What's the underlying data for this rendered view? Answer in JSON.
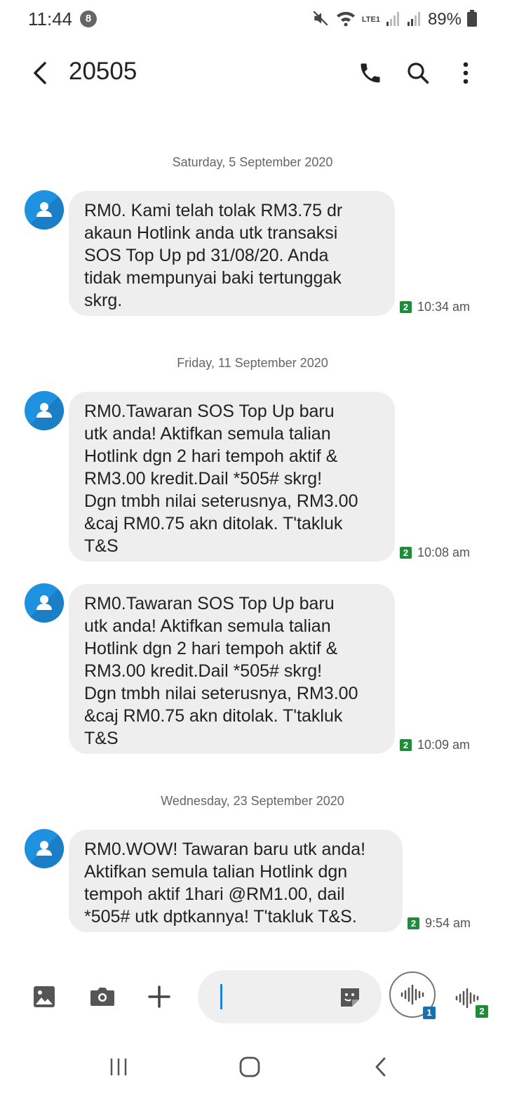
{
  "status_bar": {
    "time": "11:44",
    "notification_count": "8",
    "battery": "89%",
    "network": "LTE1"
  },
  "header": {
    "title": "20505",
    "icons": [
      "back-arrow-icon",
      "phone-icon",
      "search-icon",
      "more-vert-icon"
    ]
  },
  "conversation": [
    {
      "date": "Saturday, 5 September 2020",
      "messages": [
        {
          "text": "RM0. Kami telah tolak RM3.75 dr\nakaun Hotlink anda utk transaksi\nSOS Top Up pd 31/08/20. Anda\ntidak mempunyai baki tertunggak\nskrg.",
          "sim": "2",
          "time": "10:34 am"
        }
      ]
    },
    {
      "date": "Friday, 11 September 2020",
      "messages": [
        {
          "text": "RM0.Tawaran SOS Top Up baru\nutk anda! Aktifkan semula talian\nHotlink dgn 2 hari tempoh aktif &\nRM3.00 kredit.Dail *505#  skrg!\nDgn tmbh nilai seterusnya, RM3.00\n&caj RM0.75 akn ditolak. T'takluk\nT&S",
          "sim": "2",
          "time": "10:08 am"
        },
        {
          "text": "RM0.Tawaran SOS Top Up baru\nutk anda! Aktifkan semula talian\nHotlink dgn 2 hari tempoh aktif &\nRM3.00 kredit.Dail *505#  skrg!\nDgn tmbh nilai seterusnya, RM3.00\n&caj RM0.75 akn ditolak. T'takluk\nT&S",
          "sim": "2",
          "time": "10:09 am"
        }
      ]
    },
    {
      "date": "Wednesday, 23 September 2020",
      "messages": [
        {
          "text": "RM0.WOW! Tawaran baru utk anda!\nAktifkan semula talian Hotlink dgn\ntempoh aktif 1hari @RM1.00, dail\n*505# utk dptkannya! T'takluk T&S.",
          "sim": "2",
          "time": "9:54 am"
        }
      ]
    }
  ],
  "composer": {
    "input_value": "",
    "voice_sim_1": "1",
    "voice_sim_2": "2",
    "icons": [
      "gallery-icon",
      "camera-icon",
      "add-icon",
      "sticker-icon",
      "voice-input-icon"
    ]
  },
  "colors": {
    "accent": "#1e92e0",
    "bubble": "#eeeeee",
    "sim_green": "#1f8c3a",
    "sim_blue": "#1a6fb0"
  }
}
